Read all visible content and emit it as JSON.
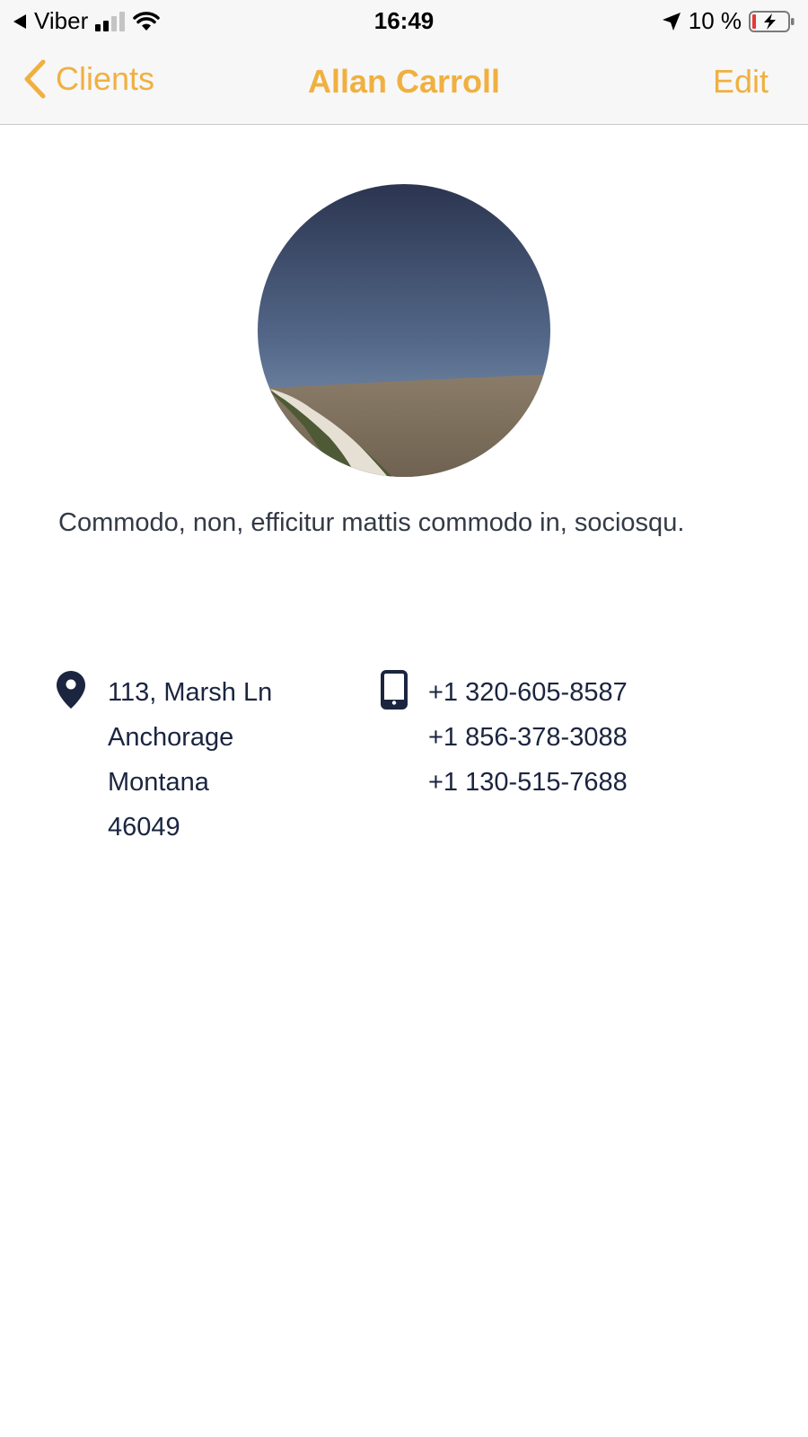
{
  "status_bar": {
    "carrier": "Viber",
    "time": "16:49",
    "battery": "10 %"
  },
  "nav": {
    "back_label": "Clients",
    "title": "Allan Carroll",
    "edit_label": "Edit"
  },
  "profile": {
    "description": "Commodo, non, efficitur mattis commodo in, sociosqu.",
    "address": {
      "street": "113, Marsh Ln",
      "city": "Anchorage",
      "state": "Montana",
      "zip": "46049"
    },
    "phones": [
      "+1 320-605-8587",
      "+1 856-378-3088",
      "+1 130-515-7688"
    ]
  },
  "colors": {
    "accent": "#f0b040",
    "text_dark": "#1b2540"
  }
}
